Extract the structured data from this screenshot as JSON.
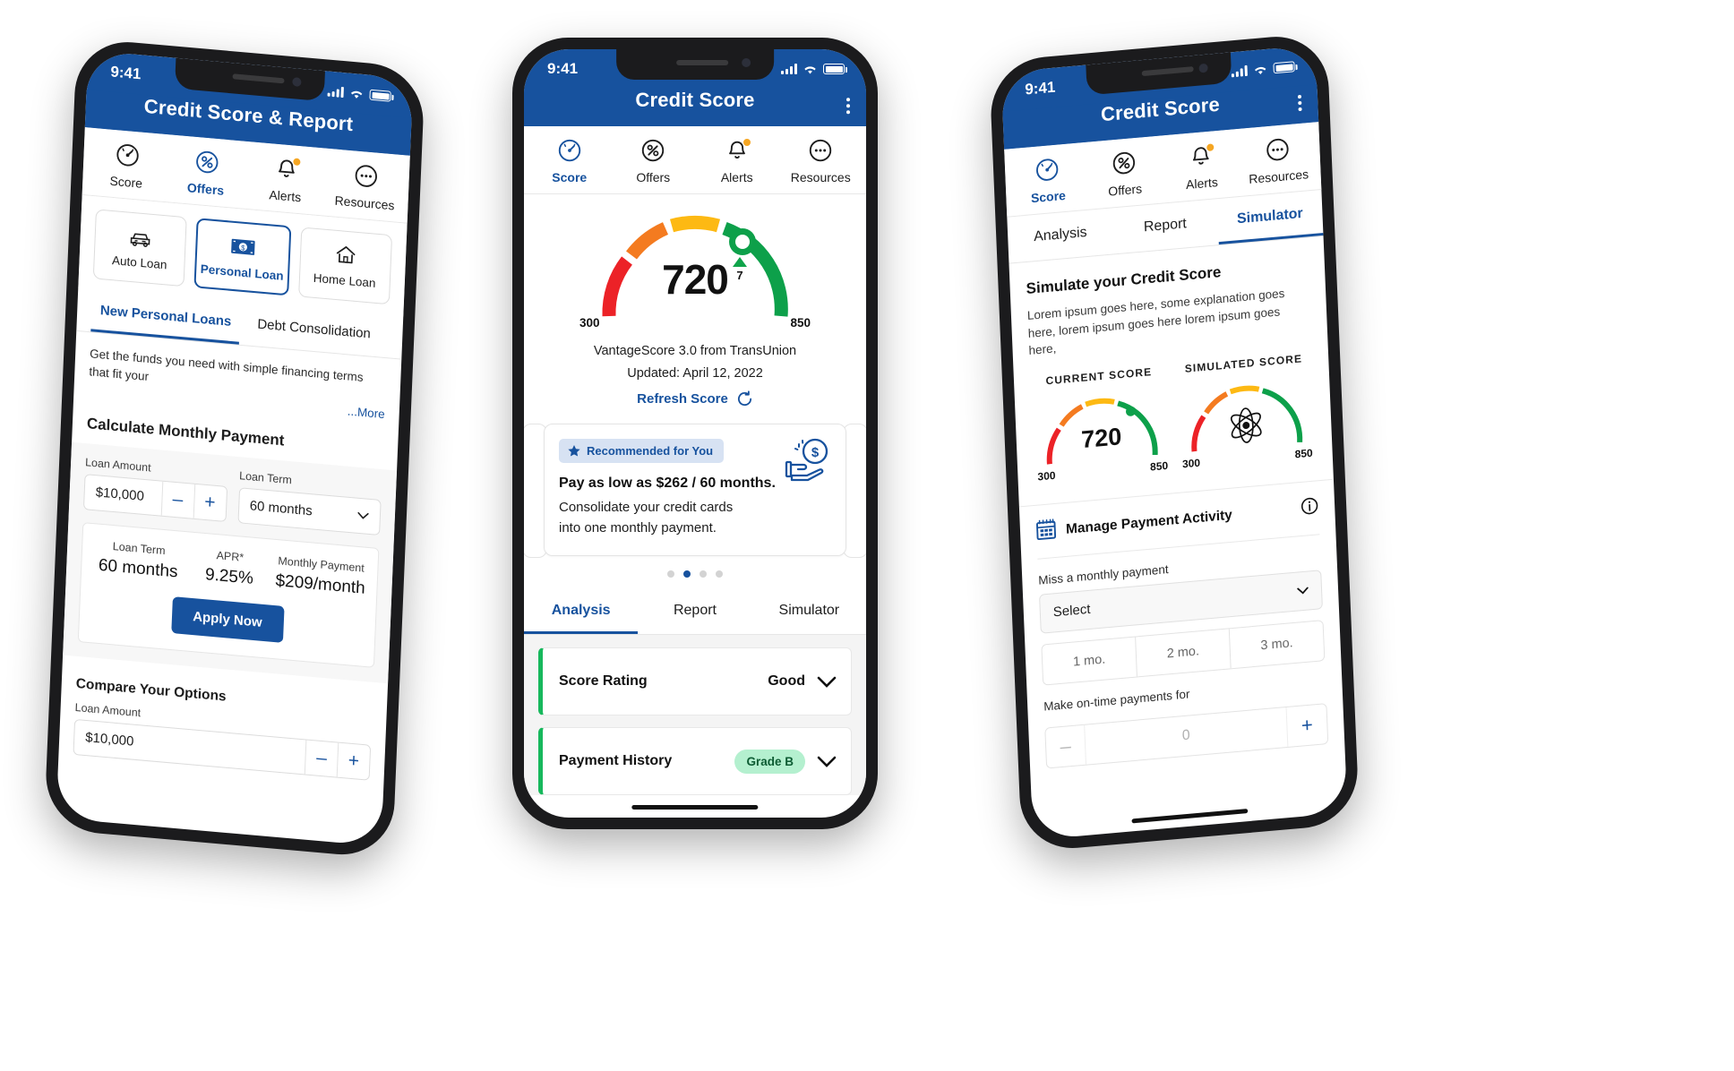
{
  "status_bar": {
    "time": "9:41"
  },
  "phone1": {
    "header": {
      "title": "Credit Score & Report"
    },
    "nav": [
      {
        "label": "Score",
        "icon": "speedometer-icon",
        "active": false,
        "badge": false
      },
      {
        "label": "Offers",
        "icon": "percent-icon",
        "active": true,
        "badge": false
      },
      {
        "label": "Alerts",
        "icon": "bell-icon",
        "active": false,
        "badge": true
      },
      {
        "label": "Resources",
        "icon": "more-circle-icon",
        "active": false,
        "badge": false
      }
    ],
    "loan_types": [
      {
        "label": "Auto Loan",
        "icon": "car-icon",
        "selected": false
      },
      {
        "label": "Personal Loan",
        "icon": "banknote-icon",
        "selected": true
      },
      {
        "label": "Home Loan",
        "icon": "house-icon",
        "selected": false
      }
    ],
    "subtabs": [
      {
        "label": "New Personal Loans",
        "active": true
      },
      {
        "label": "Debt Consolidation",
        "active": false
      }
    ],
    "blurb": "Get the funds you need with simple financing terms that fit your",
    "more_link": "...More",
    "calculate_title": "Calculate Monthly Payment",
    "loan_amount_label": "Loan Amount",
    "loan_amount_value": "$10,000",
    "loan_term_label": "Loan Term",
    "loan_term_value": "60 months",
    "minus_label": "–",
    "plus_label": "+",
    "result": {
      "term_label": "Loan Term",
      "term_value": "60 months",
      "apr_label": "APR*",
      "apr_value": "9.25%",
      "payment_label": "Monthly Payment",
      "payment_value": "$209/month"
    },
    "apply_label": "Apply Now",
    "compare_title": "Compare Your Options",
    "compare_amount_label": "Loan Amount",
    "compare_amount_value": "$10,000"
  },
  "phone2": {
    "header": {
      "title": "Credit Score"
    },
    "nav": [
      {
        "label": "Score",
        "icon": "speedometer-icon",
        "active": true,
        "badge": false
      },
      {
        "label": "Offers",
        "icon": "percent-icon",
        "active": false,
        "badge": false
      },
      {
        "label": "Alerts",
        "icon": "bell-icon",
        "active": false,
        "badge": true
      },
      {
        "label": "Resources",
        "icon": "more-circle-icon",
        "active": false,
        "badge": false
      }
    ],
    "gauge": {
      "score": "720",
      "delta": "7",
      "delta_direction": "up",
      "min": "300",
      "max": "850"
    },
    "bureau": "VantageScore 3.0 from TransUnion",
    "updated": "Updated: April 12, 2022",
    "refresh_label": "Refresh Score",
    "offer": {
      "pill": "Recommended for You",
      "headline": "Pay as low as $262 / 60 months.",
      "line1": "Consolidate your credit cards",
      "line2": "into one monthly payment."
    },
    "carousel_dots": 4,
    "carousel_active": 1,
    "tabs": [
      {
        "label": "Analysis",
        "active": true
      },
      {
        "label": "Report",
        "active": false
      },
      {
        "label": "Simulator",
        "active": false
      }
    ],
    "accordion": [
      {
        "name": "Score Rating",
        "value": "Good",
        "pill": null
      },
      {
        "name": "Payment History",
        "value": null,
        "pill": "Grade B"
      }
    ]
  },
  "phone3": {
    "header": {
      "title": "Credit Score"
    },
    "nav": [
      {
        "label": "Score",
        "icon": "speedometer-icon",
        "active": true,
        "badge": false
      },
      {
        "label": "Offers",
        "icon": "percent-icon",
        "active": false,
        "badge": false
      },
      {
        "label": "Alerts",
        "icon": "bell-icon",
        "active": false,
        "badge": true
      },
      {
        "label": "Resources",
        "icon": "more-circle-icon",
        "active": false,
        "badge": false
      }
    ],
    "tabs": [
      {
        "label": "Analysis",
        "active": false
      },
      {
        "label": "Report",
        "active": false
      },
      {
        "label": "Simulator",
        "active": true
      }
    ],
    "sim_title": "Simulate your Credit Score",
    "sim_desc": "Lorem ipsum goes here, some explanation goes here, lorem ipsum goes here lorem ipsum goes here,",
    "current": {
      "caption": "CURRENT SCORE",
      "score": "720",
      "min": "300",
      "max": "850"
    },
    "simulated": {
      "caption": "SIMULATED SCORE",
      "score": "",
      "min": "300",
      "max": "850"
    },
    "manage_title": "Manage Payment Activity",
    "miss_label": "Miss a monthly payment",
    "select_value": "Select",
    "seg_options": [
      "1 mo.",
      "2 mo.",
      "3 mo."
    ],
    "ontime_label": "Make on-time payments for",
    "ontime_value": "0",
    "minus_label": "–",
    "plus_label": "+"
  },
  "colors": {
    "brand_blue": "#17529e",
    "gauge_red": "#ec2227",
    "gauge_orange": "#f47b20",
    "gauge_yellow": "#fdb913",
    "gauge_green": "#0da04a",
    "grade_pill_bg": "#b4f0cf"
  }
}
